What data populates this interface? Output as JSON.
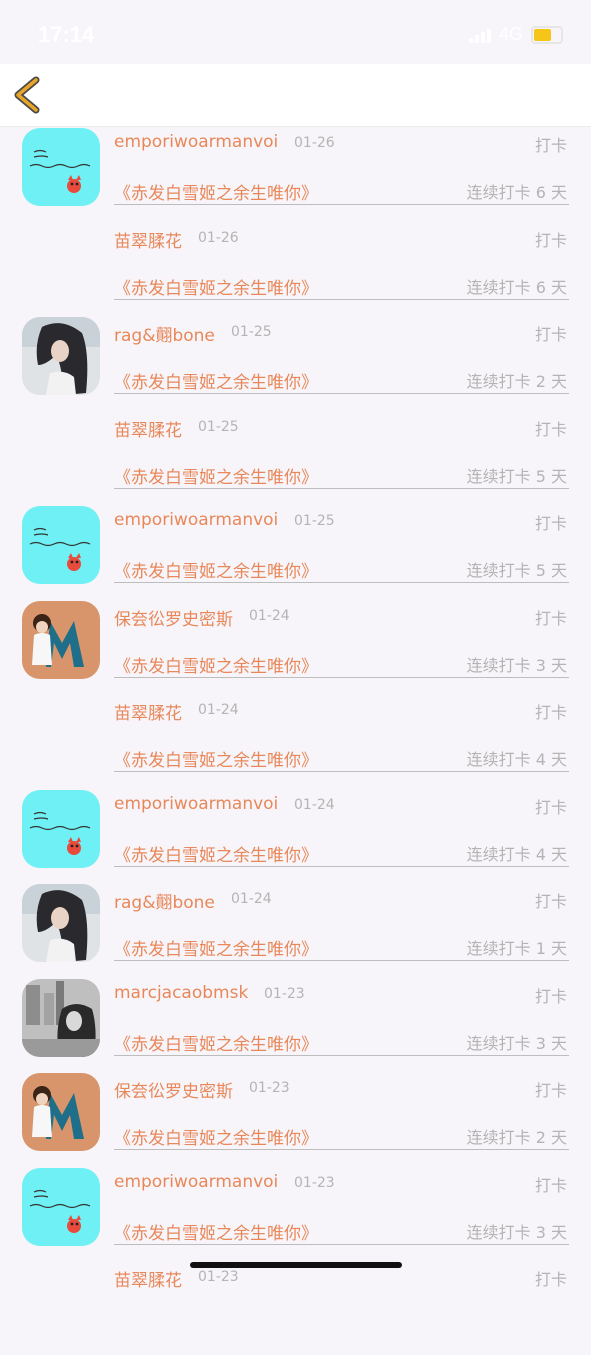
{
  "status_bar": {
    "time": "17:14",
    "network": "4G"
  },
  "nav": {
    "back_icon": "chevron-left-icon",
    "accent_color": "#e8a52a"
  },
  "colors": {
    "name_color": "#e8885a",
    "muted_color": "#b4b4b4",
    "divider_color": "#bdbdbd"
  },
  "records": [
    {
      "username": "emporiwoarmanvoi",
      "date": "01-26",
      "label": "打卡",
      "book": "《赤发白雪姬之余生唯你》",
      "streak": "连续打卡 6 天",
      "avatar": "avatar-cyan",
      "show_avatar": true
    },
    {
      "username": "苗翠腬花",
      "date": "01-26",
      "label": "打卡",
      "book": "《赤发白雪姬之余生唯你》",
      "streak": "连续打卡 6 天",
      "avatar": "",
      "show_avatar": false
    },
    {
      "username": "rag&翸bone",
      "date": "01-25",
      "label": "打卡",
      "book": "《赤发白雪姬之余生唯你》",
      "streak": "连续打卡 2 天",
      "avatar": "avatar-girl",
      "show_avatar": true
    },
    {
      "username": "苗翠腬花",
      "date": "01-25",
      "label": "打卡",
      "book": "《赤发白雪姬之余生唯你》",
      "streak": "连续打卡 5 天",
      "avatar": "",
      "show_avatar": false
    },
    {
      "username": "emporiwoarmanvoi",
      "date": "01-25",
      "label": "打卡",
      "book": "《赤发白雪姬之余生唯你》",
      "streak": "连续打卡 5 天",
      "avatar": "avatar-cyan",
      "show_avatar": true
    },
    {
      "username": "保夽彸罗史密斯",
      "date": "01-24",
      "label": "打卡",
      "book": "《赤发白雪姬之余生唯你》",
      "streak": "连续打卡 3 天",
      "avatar": "avatar-m",
      "show_avatar": true
    },
    {
      "username": "苗翠腬花",
      "date": "01-24",
      "label": "打卡",
      "book": "《赤发白雪姬之余生唯你》",
      "streak": "连续打卡 4 天",
      "avatar": "",
      "show_avatar": false
    },
    {
      "username": "emporiwoarmanvoi",
      "date": "01-24",
      "label": "打卡",
      "book": "《赤发白雪姬之余生唯你》",
      "streak": "连续打卡 4 天",
      "avatar": "avatar-cyan",
      "show_avatar": true
    },
    {
      "username": "rag&翸bone",
      "date": "01-24",
      "label": "打卡",
      "book": "《赤发白雪姬之余生唯你》",
      "streak": "连续打卡 1 天",
      "avatar": "avatar-girl",
      "show_avatar": true
    },
    {
      "username": "marcjacaobmsk",
      "date": "01-23",
      "label": "打卡",
      "book": "《赤发白雪姬之余生唯你》",
      "streak": "连续打卡 3 天",
      "avatar": "avatar-bw",
      "show_avatar": true
    },
    {
      "username": "保夽彸罗史密斯",
      "date": "01-23",
      "label": "打卡",
      "book": "《赤发白雪姬之余生唯你》",
      "streak": "连续打卡 2 天",
      "avatar": "avatar-m",
      "show_avatar": true
    },
    {
      "username": "emporiwoarmanvoi",
      "date": "01-23",
      "label": "打卡",
      "book": "《赤发白雪姬之余生唯你》",
      "streak": "连续打卡 3 天",
      "avatar": "avatar-cyan",
      "show_avatar": true
    },
    {
      "username": "苗翠腬花",
      "date": "01-23",
      "label": "打卡",
      "book": "",
      "streak": "",
      "avatar": "",
      "show_avatar": false
    }
  ]
}
